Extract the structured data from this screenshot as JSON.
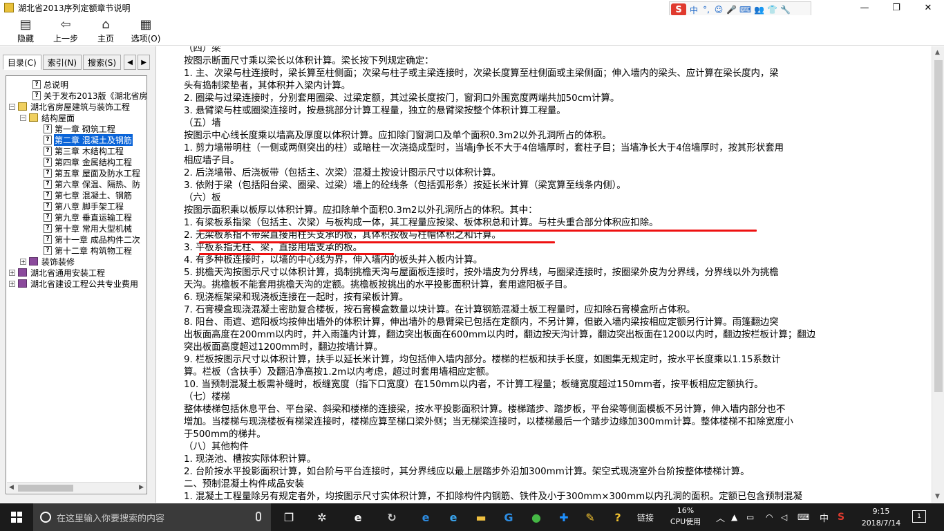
{
  "window": {
    "title": "湖北省2013序列定额章节说明",
    "controls": {
      "minimize": "—",
      "maximize": "❐",
      "close": "✕"
    }
  },
  "ime_bar": {
    "logo": "S",
    "items": [
      "中",
      "°,",
      "☺",
      "🎤",
      "⌨",
      "👥",
      "👕",
      "🔧"
    ]
  },
  "toolbar": {
    "buttons": [
      {
        "label": "隐藏",
        "icon": "hide-icon",
        "glyph": "▤"
      },
      {
        "label": "上一步",
        "icon": "back-arrow-icon",
        "glyph": "⇦"
      },
      {
        "label": "主页",
        "icon": "home-icon",
        "glyph": "⌂"
      },
      {
        "label": "选项(O)",
        "icon": "options-icon",
        "glyph": "▦"
      }
    ]
  },
  "left_pane": {
    "tabs": [
      "目录(C)",
      "索引(N)",
      "搜索(S)"
    ],
    "tree": [
      {
        "label": "总说明",
        "indent": 1,
        "type": "page"
      },
      {
        "label": "关于发布2013版《湖北省房屋",
        "indent": 1,
        "type": "page"
      },
      {
        "label": "湖北省房屋建筑与装饰工程",
        "indent": 0,
        "type": "book-open",
        "expander": "−"
      },
      {
        "label": "结构屋面",
        "indent": 1,
        "type": "book-open",
        "expander": "−"
      },
      {
        "label": "第一章 砌筑工程",
        "indent": 2,
        "type": "page"
      },
      {
        "label": "第二章 混凝土及钢筋",
        "indent": 2,
        "type": "page",
        "selected": true
      },
      {
        "label": "第三章 木结构工程",
        "indent": 2,
        "type": "page"
      },
      {
        "label": "第四章 金属结构工程",
        "indent": 2,
        "type": "page"
      },
      {
        "label": "第五章 屋面及防水工程",
        "indent": 2,
        "type": "page"
      },
      {
        "label": "第六章 保温、隔热、防",
        "indent": 2,
        "type": "page"
      },
      {
        "label": "第七章 混凝土、钢筋",
        "indent": 2,
        "type": "page"
      },
      {
        "label": "第八章 脚手架工程",
        "indent": 2,
        "type": "page"
      },
      {
        "label": "第九章 垂直运输工程",
        "indent": 2,
        "type": "page"
      },
      {
        "label": "第十章 常用大型机械",
        "indent": 2,
        "type": "page"
      },
      {
        "label": "第十一章 成品构件二次",
        "indent": 2,
        "type": "page"
      },
      {
        "label": "第十二章 构筑物工程",
        "indent": 2,
        "type": "page"
      },
      {
        "label": "装饰装修",
        "indent": 1,
        "type": "book",
        "expander": "+"
      },
      {
        "label": "湖北省通用安装工程",
        "indent": 0,
        "type": "book",
        "expander": "+"
      },
      {
        "label": "湖北省建设工程公共专业费用",
        "indent": 0,
        "type": "book",
        "expander": "+"
      }
    ]
  },
  "content": {
    "lines": [
      "（四）梁",
      "按图示断面尺寸乘以梁长以体积计算。梁长按下列规定确定：",
      "1. 主、次梁与柱连接时，梁长算至柱侧面；次梁与柱子或主梁连接时，次梁长度算至柱侧面或主梁侧面；伸入墙内的梁头、应计算在梁长度内，梁",
      "头有捣制梁垫者，其体积并入梁内计算。",
      "2. 圈梁与过梁连接时，分别套用圈梁、过梁定额，其过梁长度按门，窗洞口外围宽度两端共加50cm计算。",
      "3. 悬臂梁与柱或圈梁连接时，按悬挑部分计算工程量，独立的悬臂梁按整个体积计算工程量。",
      "（五）墙",
      "按图示中心线长度乘以墙高及厚度以体积计算。应扣除门窗洞口及单个面积0.3m2以外孔洞所占的体积。",
      "1. 剪力墙带明柱（一侧或两侧突出的柱）或暗柱一次浇捣成型时，当墙j争长不大于4倍墙厚时，套柱子目；当墙净长大于4倍墙厚时，按其形状套用",
      "相应墙子目。",
      "2. 后浇墙带、后浇板带（包括主、次梁）混凝土按设计图示尺寸以体积计算。",
      "3. 依附于梁（包括阳台梁、圈梁、过梁）墙上的砼线条（包括弧形条）按延长米计算（梁宽算至线条内侧）。",
      "（六）板",
      "按图示面积乘以板厚以体积计算。应扣除单个面积0.3m2以外孔洞所占的体积。其中：",
      "1. 有梁板系指梁（包括主、次梁）与板构成一体，其工程量应按梁、板体积总和计算。与柱头重合部分体积应扣除。",
      "2. 无梁板系指不带梁直接用柱头支承的板，其体积按板与柱帽体积之和计算。",
      "3. 平板系指无柱、梁，直接用墙支承的板。",
      "4. 有多种板连接时，以墙的中心线为界，伸入墙内的板头并入板内计算。",
      "5. 挑檐天沟按图示尺寸以体积计算，捣制挑檐天沟与屋面板连接时，按外墙皮为分界线，与圈梁连接时，按圈梁外皮为分界线，分界线以外为挑檐",
      "天沟。挑檐板不能套用挑檐天沟的定额。挑檐板按挑出的水平投影面积计算，套用遮阳板子目。",
      "6. 现浇框架梁和现浇板连接在一起时，按有梁板计算。",
      "7. 石膏模盒现浇混凝土密肋复合楼板，按石膏模盒数量以块计算。在计算钢筋混凝土板工程量时，应扣除石膏模盒所占体积。",
      "8. 阳台、雨遮、遮阳板均按伸出墙外的体积计算，伸出墙外的悬臂梁已包括在定额内，不另计算，但嵌入墙内梁按相应定额另行计算。雨篷翻边突",
      "出板面高度在200mm以内时，并入雨篷内计算，翻边突出板面在600mm以内时，翻边按天沟计算，翻边突出板面在1200以内时，翻边按栏板计算；翻边",
      "突出板面高度超过1200mm时，翻边按墙计算。",
      "9. 栏板按图示尺寸以体积计算，扶手以延长米计算，均包括伸入墙内部分。楼梯的栏板和扶手长度，如图集无规定时，按水平长度乘以1.15系数计",
      "算。栏板（含扶手）及翻沿净高按1.2m以内考虑，超过时套用墙相应定额。",
      "10. 当预制混凝土板需补缝时，板缝宽度（指下口宽度）在150mm以内者，不计算工程量；板缝宽度超过150mm者，按平板相应定额执行。",
      "（七）楼梯",
      "整体楼梯包括休息平台、平台梁、斜梁和楼梯的连接梁，按水平投影面积计算。楼梯踏步、踏步板，平台梁等侧面模板不另计算，伸入墙内部分也不",
      "增加。当楼梯与现浇楼板有梯梁连接时，楼梯应算至梯口梁外侧；当无梯梁连接时，以楼梯最后一个踏步边缘加300mm计算。整体楼梯不扣除宽度小",
      "于500mm的梯井。",
      "（八）其他构件",
      "1. 现浇池、槽按实际体积计算。",
      "2. 台阶按水平投影面积计算，如台阶与平台连接时，其分界线应以最上层踏步外沿加300mm计算。架空式现浇室外台阶按整体楼梯计算。",
      "二、预制混凝土构件成品安装",
      "1. 混凝土工程量除另有规定者外，均按图示尺寸实体积计算，不扣除构件内钢筋、铁件及小于300mm×300mm以内孔洞的面积。定额已包含预制混凝"
    ]
  },
  "taskbar": {
    "search_placeholder": "在这里输入你要搜索的内容",
    "apps": [
      {
        "name": "task-view-icon",
        "glyph": "❐",
        "color": "#ffffff"
      },
      {
        "name": "fan-app-icon",
        "glyph": "✲",
        "color": "#ffffff"
      },
      {
        "name": "ie-icon",
        "glyph": "e",
        "color": "#ffffff"
      },
      {
        "name": "swirl-app-icon",
        "glyph": "↻",
        "color": "#cccccc"
      },
      {
        "name": "edge-icon",
        "glyph": "e",
        "color": "#2d8de3"
      },
      {
        "name": "ie-blue-icon",
        "glyph": "e",
        "color": "#3aa6f0"
      },
      {
        "name": "folder-icon",
        "glyph": "▬",
        "color": "#f0c040"
      },
      {
        "name": "g-app-icon",
        "glyph": "G",
        "color": "#2d8de3"
      },
      {
        "name": "green-browser-icon",
        "glyph": "●",
        "color": "#45b845"
      },
      {
        "name": "plus-app-icon",
        "glyph": "✚",
        "color": "#1e90ff"
      },
      {
        "name": "notes-app-icon",
        "glyph": "✎",
        "color": "#f2c230"
      },
      {
        "name": "help-app-icon",
        "glyph": "?",
        "color": "#f2c230"
      }
    ],
    "links_label": "链接",
    "cpu_percent": "16%",
    "cpu_label": "CPU使用",
    "tray_lang": "中",
    "tray_ime": "S",
    "time": "9:15",
    "date": "2018/7/14",
    "notification_count": "1"
  }
}
